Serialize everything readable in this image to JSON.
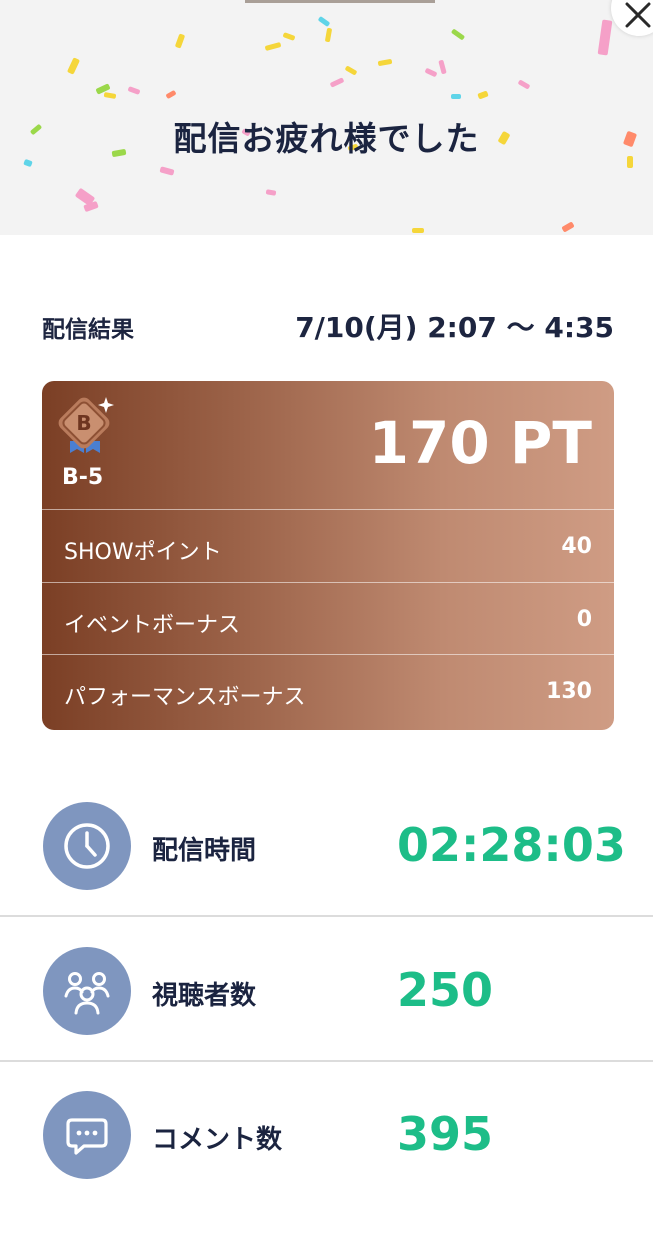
{
  "header": {
    "title": "配信お疲れ様でした"
  },
  "result": {
    "label": "配信結果",
    "time_range": "7/10(月) 2:07 〜 4:35"
  },
  "points": {
    "badge_letter": "B",
    "rank": "B-5",
    "total": "170 PT",
    "rows": [
      {
        "label": "SHOWポイント",
        "value": "40"
      },
      {
        "label": "イベントボーナス",
        "value": "0"
      },
      {
        "label": "パフォーマンスボーナス",
        "value": "130"
      }
    ]
  },
  "stats": [
    {
      "label": "配信時間",
      "value": "02:28:03",
      "icon": "clock-icon"
    },
    {
      "label": "視聴者数",
      "value": "250",
      "icon": "viewers-icon"
    },
    {
      "label": "コメント数",
      "value": "395",
      "icon": "comment-icon"
    }
  ],
  "colors": {
    "accent_green": "#1dbd88",
    "card_brown_dark": "#7b3f25",
    "card_brown_light": "#cf9c84",
    "icon_circle": "#7f96bf",
    "text_navy": "#1b2440"
  }
}
